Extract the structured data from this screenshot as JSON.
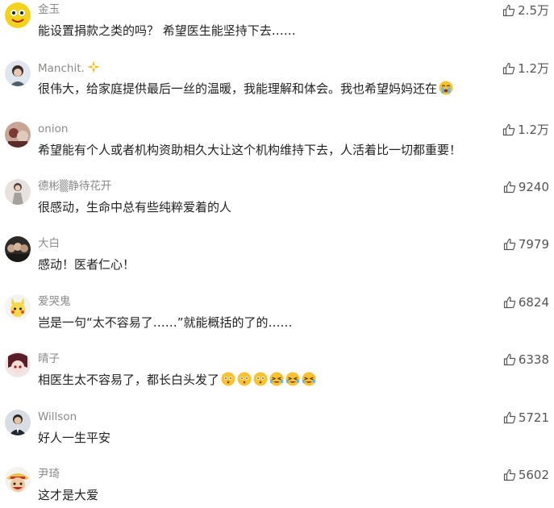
{
  "comments": [
    {
      "name": "金玉",
      "text": "能设置捐款之类的吗？  希望医生能坚持下去……",
      "likes": "2.5万"
    },
    {
      "name": "Manchit.",
      "text": "很伟大，给家庭提供最后一丝的温暖，我能理解和体会。我也希望妈妈还在",
      "likes": "1.2万"
    },
    {
      "name": "onion",
      "text": "希望能有个人或者机构资助相久大让这个机构维持下去，人活着比一切都重要！",
      "likes": "1.2万"
    },
    {
      "name": "德彬▒静待花开",
      "text": "很感动，生命中总有些纯粹爱着的人",
      "likes": "9240"
    },
    {
      "name": "大白",
      "text": "感动！医者仁心！",
      "likes": "7979"
    },
    {
      "name": "爱哭鬼",
      "text": "岂是一句“太不容易了……”就能概括的了的……",
      "likes": "6824"
    },
    {
      "name": "晴子",
      "text": "相医生太不容易了，都长白头发了",
      "likes": "6338"
    },
    {
      "name": "Willson",
      "text": "好人一生平安",
      "likes": "5721"
    },
    {
      "name": "尹琦",
      "text": "这才是大爱",
      "likes": "5602"
    }
  ],
  "icons": {
    "like": "thumbs-up-icon",
    "badge": "sparkle-badge-icon"
  },
  "colors": {
    "name": "#8a8a8a",
    "text": "#222222",
    "like_icon": "#555555"
  }
}
